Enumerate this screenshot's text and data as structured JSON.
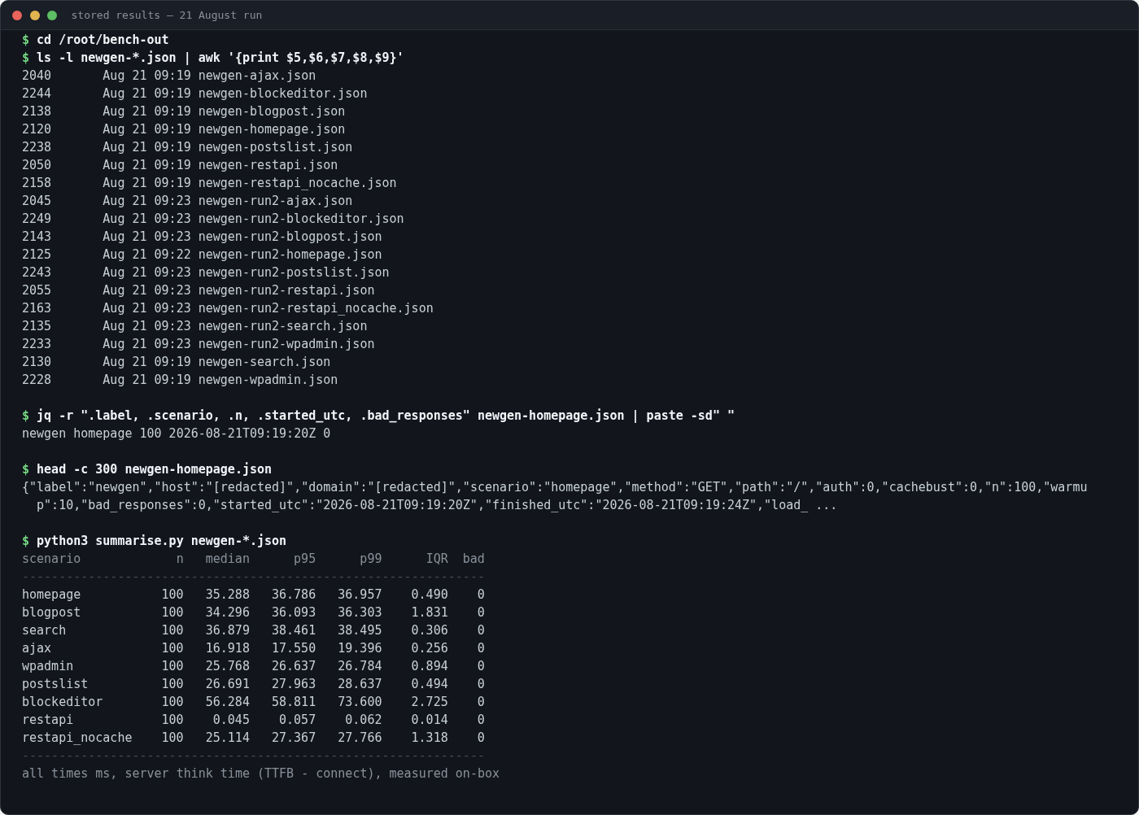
{
  "window": {
    "title": "stored results — 21 August run"
  },
  "blocks": [
    {
      "lines": [
        {
          "kind": "command",
          "prompt": "$",
          "command": "cd /root/bench-out"
        },
        {
          "kind": "command",
          "prompt": "$",
          "command": "ls -l newgen-*.json | awk '{print $5,$6,$7,$8,$9}'"
        },
        {
          "kind": "listing",
          "size": "2040",
          "date": "Aug 21 09:19",
          "file": "newgen-ajax.json"
        },
        {
          "kind": "listing",
          "size": "2244",
          "date": "Aug 21 09:19",
          "file": "newgen-blockeditor.json"
        },
        {
          "kind": "listing",
          "size": "2138",
          "date": "Aug 21 09:19",
          "file": "newgen-blogpost.json"
        },
        {
          "kind": "listing",
          "size": "2120",
          "date": "Aug 21 09:19",
          "file": "newgen-homepage.json"
        },
        {
          "kind": "listing",
          "size": "2238",
          "date": "Aug 21 09:19",
          "file": "newgen-postslist.json"
        },
        {
          "kind": "listing",
          "size": "2050",
          "date": "Aug 21 09:19",
          "file": "newgen-restapi.json"
        },
        {
          "kind": "listing",
          "size": "2158",
          "date": "Aug 21 09:19",
          "file": "newgen-restapi_nocache.json"
        },
        {
          "kind": "listing",
          "size": "2045",
          "date": "Aug 21 09:23",
          "file": "newgen-run2-ajax.json"
        },
        {
          "kind": "listing",
          "size": "2249",
          "date": "Aug 21 09:23",
          "file": "newgen-run2-blockeditor.json"
        },
        {
          "kind": "listing",
          "size": "2143",
          "date": "Aug 21 09:23",
          "file": "newgen-run2-blogpost.json"
        },
        {
          "kind": "listing",
          "size": "2125",
          "date": "Aug 21 09:22",
          "file": "newgen-run2-homepage.json"
        },
        {
          "kind": "listing",
          "size": "2243",
          "date": "Aug 21 09:23",
          "file": "newgen-run2-postslist.json"
        },
        {
          "kind": "listing",
          "size": "2055",
          "date": "Aug 21 09:23",
          "file": "newgen-run2-restapi.json"
        },
        {
          "kind": "listing",
          "size": "2163",
          "date": "Aug 21 09:23",
          "file": "newgen-run2-restapi_nocache.json"
        },
        {
          "kind": "listing",
          "size": "2135",
          "date": "Aug 21 09:23",
          "file": "newgen-run2-search.json"
        },
        {
          "kind": "listing",
          "size": "2233",
          "date": "Aug 21 09:23",
          "file": "newgen-run2-wpadmin.json"
        },
        {
          "kind": "listing",
          "size": "2130",
          "date": "Aug 21 09:19",
          "file": "newgen-search.json"
        },
        {
          "kind": "listing",
          "size": "2228",
          "date": "Aug 21 09:19",
          "file": "newgen-wpadmin.json"
        }
      ]
    },
    {
      "lines": [
        {
          "kind": "command",
          "prompt": "$",
          "command": "jq -r \".label, .scenario, .n, .started_utc, .bad_responses\" newgen-homepage.json | paste -sd\" \""
        },
        {
          "kind": "output",
          "text": "newgen homepage 100 2026-08-21T09:19:20Z 0"
        }
      ]
    },
    {
      "lines": [
        {
          "kind": "command",
          "prompt": "$",
          "command": "head -c 300 newgen-homepage.json"
        },
        {
          "kind": "output",
          "text": "{\"label\":\"newgen\",\"host\":\"[redacted]\",\"domain\":\"[redacted]\",\"scenario\":\"homepage\",\"method\":\"GET\",\"path\":\"/\",\"auth\":0,\"cachebust\":0,\"n\":100,\"warmu"
        },
        {
          "kind": "continuation",
          "text": "p\":10,\"bad_responses\":0,\"started_utc\":\"2026-08-21T09:19:20Z\",\"finished_utc\":\"2026-08-21T09:19:24Z\",\"load_ ..."
        }
      ]
    },
    {
      "lines": [
        {
          "kind": "command",
          "prompt": "$",
          "command": "python3 summarise.py newgen-*.json"
        },
        {
          "kind": "table_header",
          "cells": [
            "scenario",
            "n",
            "median",
            "p95",
            "p99",
            "IQR",
            "bad"
          ]
        },
        {
          "kind": "rule",
          "text": "---------------------------------------------------------------"
        },
        {
          "kind": "table_row",
          "cells": [
            "homepage",
            "100",
            "35.288",
            "36.786",
            "36.957",
            "0.490",
            "0"
          ]
        },
        {
          "kind": "table_row",
          "cells": [
            "blogpost",
            "100",
            "34.296",
            "36.093",
            "36.303",
            "1.831",
            "0"
          ]
        },
        {
          "kind": "table_row",
          "cells": [
            "search",
            "100",
            "36.879",
            "38.461",
            "38.495",
            "0.306",
            "0"
          ]
        },
        {
          "kind": "table_row",
          "cells": [
            "ajax",
            "100",
            "16.918",
            "17.550",
            "19.396",
            "0.256",
            "0"
          ]
        },
        {
          "kind": "table_row",
          "cells": [
            "wpadmin",
            "100",
            "25.768",
            "26.637",
            "26.784",
            "0.894",
            "0"
          ]
        },
        {
          "kind": "table_row",
          "cells": [
            "postslist",
            "100",
            "26.691",
            "27.963",
            "28.637",
            "0.494",
            "0"
          ]
        },
        {
          "kind": "table_row",
          "cells": [
            "blockeditor",
            "100",
            "56.284",
            "58.811",
            "73.600",
            "2.725",
            "0"
          ]
        },
        {
          "kind": "table_row",
          "cells": [
            "restapi",
            "100",
            "0.045",
            "0.057",
            "0.062",
            "0.014",
            "0"
          ]
        },
        {
          "kind": "table_row",
          "cells": [
            "restapi_nocache",
            "100",
            "25.114",
            "27.367",
            "27.766",
            "1.318",
            "0"
          ]
        },
        {
          "kind": "rule",
          "text": "---------------------------------------------------------------"
        },
        {
          "kind": "note",
          "text": "all times ms, server think time (TTFB - connect), measured on-box"
        }
      ]
    }
  ]
}
